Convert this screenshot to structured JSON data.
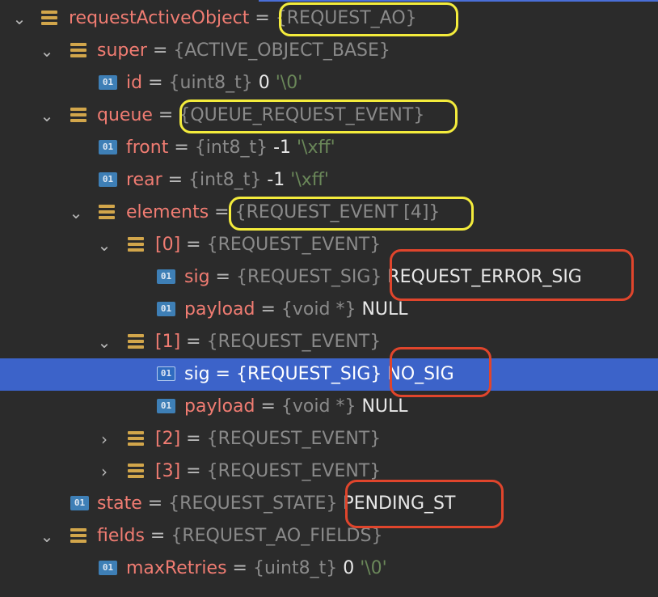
{
  "rows": [
    {
      "name": "requestActiveObject",
      "eq": " = ",
      "type": "{REQUEST_AO}",
      "value": "",
      "str": ""
    },
    {
      "name": "super",
      "eq": " = ",
      "type": "{ACTIVE_OBJECT_BASE}",
      "value": "",
      "str": ""
    },
    {
      "name": "id",
      "eq": " = ",
      "type": "{uint8_t}",
      "value": " 0 ",
      "str": "'\\0'"
    },
    {
      "name": "queue",
      "eq": " = ",
      "type": "{QUEUE_REQUEST_EVENT}",
      "value": "",
      "str": ""
    },
    {
      "name": "front",
      "eq": " = ",
      "type": "{int8_t}",
      "value": " -1 ",
      "str": "'\\xff'"
    },
    {
      "name": "rear",
      "eq": " = ",
      "type": "{int8_t}",
      "value": " -1 ",
      "str": "'\\xff'"
    },
    {
      "name": "elements",
      "eq": " = ",
      "type": "{REQUEST_EVENT [4]}",
      "value": "",
      "str": ""
    },
    {
      "name": "[0]",
      "eq": " = ",
      "type": "{REQUEST_EVENT}",
      "value": "",
      "str": ""
    },
    {
      "name": "sig",
      "eq": " = ",
      "type": "{REQUEST_SIG}",
      "value": " REQUEST_ERROR_SIG",
      "str": ""
    },
    {
      "name": "payload",
      "eq": " = ",
      "type": "{void *}",
      "value": " NULL",
      "str": ""
    },
    {
      "name": "[1]",
      "eq": " = ",
      "type": "{REQUEST_EVENT}",
      "value": "",
      "str": ""
    },
    {
      "name": "sig",
      "eq": " = ",
      "type": "{REQUEST_SIG}",
      "value": " NO_SIG",
      "str": ""
    },
    {
      "name": "payload",
      "eq": " = ",
      "type": "{void *}",
      "value": " NULL",
      "str": ""
    },
    {
      "name": "[2]",
      "eq": " = ",
      "type": "{REQUEST_EVENT}",
      "value": "",
      "str": ""
    },
    {
      "name": "[3]",
      "eq": " = ",
      "type": "{REQUEST_EVENT}",
      "value": "",
      "str": ""
    },
    {
      "name": "state",
      "eq": " = ",
      "type": "{REQUEST_STATE}",
      "value": " PENDING_ST",
      "str": ""
    },
    {
      "name": "fields",
      "eq": " = ",
      "type": "{REQUEST_AO_FIELDS}",
      "value": "",
      "str": ""
    },
    {
      "name": "maxRetries",
      "eq": " = ",
      "type": "{uint8_t}",
      "value": " 0 ",
      "str": "'\\0'"
    }
  ],
  "icons": {
    "struct": "struct-field-icon",
    "value": "primitive-value-icon",
    "value_glyph": "01",
    "expanded": "chevron-down-icon",
    "collapsed": "chevron-right-icon"
  },
  "colors": {
    "background": "#2b2b2b",
    "selection": "#3c63c9",
    "field_name": "#f07c72",
    "type": "#8a8a8a",
    "string_literal": "#6a8759",
    "annotation_yellow": "#f4ec3c",
    "annotation_red": "#e0452c"
  },
  "selected_row": 11
}
